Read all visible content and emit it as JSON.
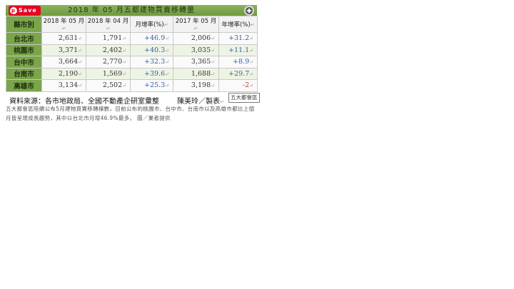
{
  "figure": {
    "title": "2018 年 05 月五都建物買賣移轉量",
    "pin_label": "Save",
    "pin_glyph": "p",
    "columns": [
      "縣市別",
      "2018 年 05 月",
      "2018 年 04 月",
      "月增率(%)",
      "2017 年 05 月",
      "年增率(%)"
    ],
    "rows": [
      {
        "city": "台北市",
        "may2018": "2,631",
        "apr2018": "1,791",
        "mom": "+46.9",
        "may2017": "2,006",
        "yoy": "+31.2"
      },
      {
        "city": "桃園市",
        "may2018": "3,371",
        "apr2018": "2,402",
        "mom": "+40.3",
        "may2017": "3,035",
        "yoy": "+11.1"
      },
      {
        "city": "台中市",
        "may2018": "3,664",
        "apr2018": "2,770",
        "mom": "+32.3",
        "may2017": "3,365",
        "yoy": "+8.9"
      },
      {
        "city": "台南市",
        "may2018": "2,190",
        "apr2018": "1,569",
        "mom": "+39.6",
        "may2017": "1,688",
        "yoy": "+29.7"
      },
      {
        "city": "高雄市",
        "may2018": "3,134",
        "apr2018": "2,502",
        "mom": "+25.3",
        "may2017": "3,198",
        "yoy": "-2"
      }
    ],
    "source": "資料來源：各市地政局、全國不動產企研室彙整",
    "maker": "陳美玲／製表",
    "mark": "↵",
    "overflow_tag": "五大都會區"
  },
  "caption": "五大都會區陸續公布5月建物買賣移轉棟數，目前公布的桃園市、台中市、台南市以及高雄市都比上個月皆呈現成長趨勢，其中以台北市月增46.9%最多。 圖／業者提供",
  "colors": {
    "header_green": "#7aa54a",
    "pin_red": "#e60023",
    "positive_blue": "#2f5fa8",
    "negative_red": "#c0392b"
  }
}
